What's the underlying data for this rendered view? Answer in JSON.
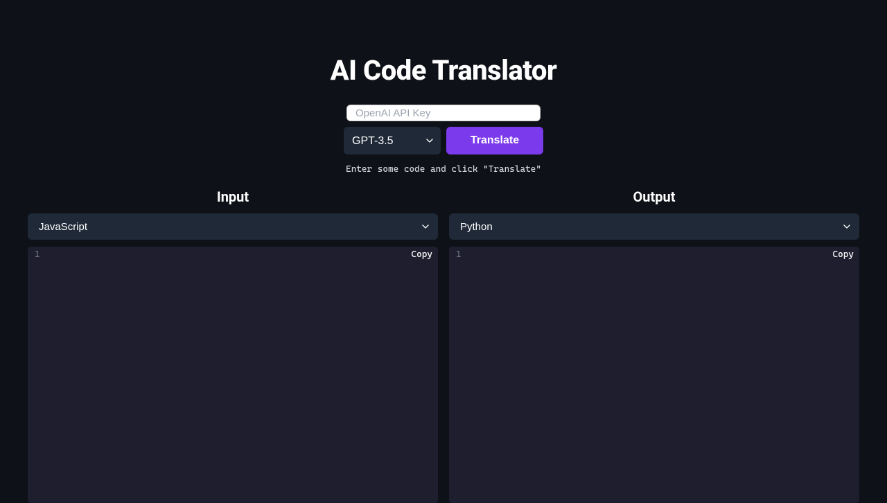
{
  "header": {
    "title": "AI Code Translator"
  },
  "apiKey": {
    "placeholder": "OpenAI API Key",
    "value": ""
  },
  "model": {
    "selected": "GPT-3.5"
  },
  "translateButton": {
    "label": "Translate"
  },
  "hint": "Enter some code and click \"Translate\"",
  "input": {
    "title": "Input",
    "language": "JavaScript",
    "lineNumber": "1",
    "copyLabel": "Copy"
  },
  "output": {
    "title": "Output",
    "language": "Python",
    "lineNumber": "1",
    "copyLabel": "Copy"
  }
}
